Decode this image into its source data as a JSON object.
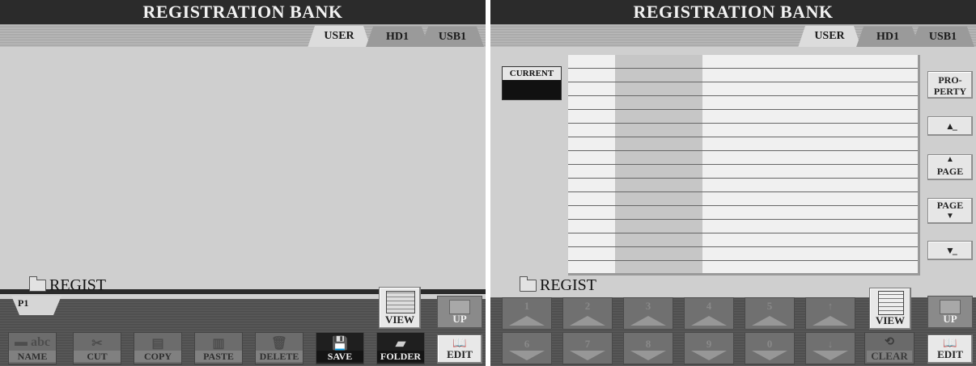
{
  "left": {
    "title": "REGISTRATION BANK",
    "tabs": [
      {
        "label": "USER",
        "active": true
      },
      {
        "label": "HD1",
        "active": false
      },
      {
        "label": "USB1",
        "active": false
      }
    ],
    "path_label": "REGIST",
    "page_tab": "P1",
    "view_label": "VIEW",
    "up_label": "UP",
    "edit_label": "EDIT",
    "function_buttons": [
      {
        "label": "NAME",
        "icon": "name-icon"
      },
      {
        "label": "CUT",
        "icon": "scissors-icon"
      },
      {
        "label": "COPY",
        "icon": "copy-icon"
      },
      {
        "label": "PASTE",
        "icon": "paste-icon"
      },
      {
        "label": "DELETE",
        "icon": "trash-icon"
      },
      {
        "label": "SAVE",
        "icon": "floppy-icon"
      },
      {
        "label": "FOLDER",
        "icon": "new-folder-icon"
      }
    ]
  },
  "right": {
    "title": "REGISTRATION BANK",
    "tabs": [
      {
        "label": "USER",
        "active": true
      },
      {
        "label": "HD1",
        "active": false
      },
      {
        "label": "USB1",
        "active": false
      }
    ],
    "current_label": "CURRENT",
    "path_label": "REGIST",
    "side_buttons": {
      "property": "PRO-\nPERTY",
      "page": "PAGE"
    },
    "top_numbers": [
      "1",
      "2",
      "3",
      "4",
      "5",
      "↑"
    ],
    "bottom_numbers": [
      "6",
      "7",
      "8",
      "9",
      "0",
      "↓"
    ],
    "view_label": "VIEW",
    "up_label": "UP",
    "clear_label": "CLEAR",
    "edit_label": "EDIT"
  },
  "colors": {
    "title_bar": "#2b2b2b",
    "content_bg": "#cfcfcf",
    "list_bg": "#f0f0f0"
  }
}
